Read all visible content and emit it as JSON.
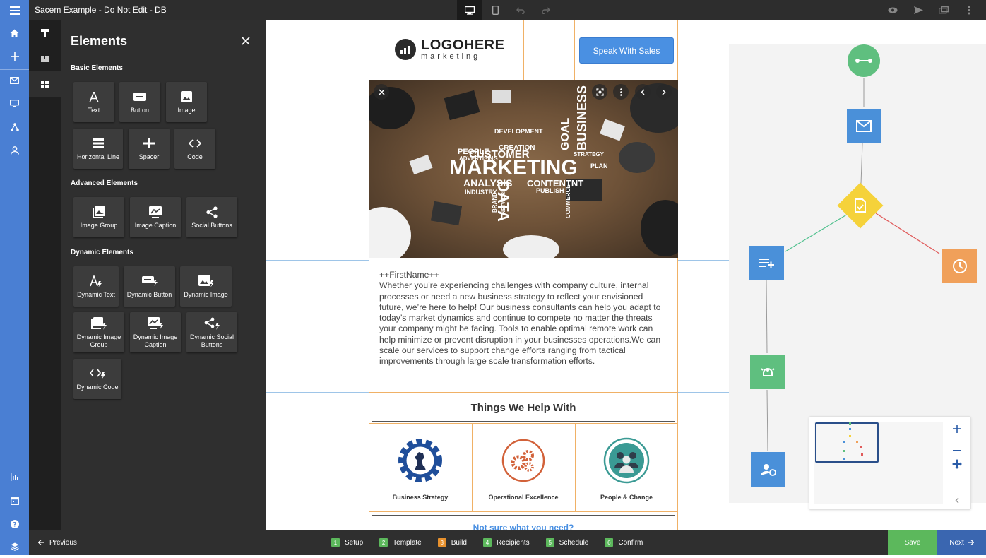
{
  "app": {
    "title": "Sacem Example - Do Not Edit - DB"
  },
  "panel": {
    "title": "Elements",
    "sections": {
      "basic": "Basic Elements",
      "advanced": "Advanced Elements",
      "dynamic": "Dynamic Elements"
    },
    "basic_items": [
      "Text",
      "Button",
      "Image",
      "Horizontal Line",
      "Spacer",
      "Code"
    ],
    "advanced_items": [
      "Image Group",
      "Image Caption",
      "Social Buttons"
    ],
    "dynamic_items": [
      "Dynamic Text",
      "Dynamic Button",
      "Dynamic Image",
      "Dynamic Image Group",
      "Dynamic Image Caption",
      "Dynamic Social Buttons",
      "Dynamic Code"
    ]
  },
  "email": {
    "logo_main": "LOGOHERE",
    "logo_sub": "marketing",
    "cta_button": "Speak With Sales",
    "greeting": "++FirstName++",
    "body": "Whether you’re experiencing challenges with company culture, internal processes or need a new business strategy to reflect your envisioned future, we’re here to help! Our business consultants can help you adapt to today’s market dynamics and continue to compete no matter the threats your company might be facing. Tools to enable optimal remote work can help minimize or prevent disruption in your businesses operations.We can scale our services to support change efforts ranging from tactical improvements through large scale transformation efforts.",
    "section_heading": "Things We Help With",
    "features": [
      "Business Strategy",
      "Operational Excellence",
      "People & Change"
    ],
    "footer_link": "Not sure what you need?",
    "hero_words": [
      "MARKETING",
      "DATA",
      "CUSTOMER",
      "BUSINESS",
      "GOAL",
      "ANALYSIS",
      "CONTENTNT",
      "CREATION",
      "DEVELOPMENT",
      "PEOPLE",
      "ADVERTISING",
      "INDUSTRY",
      "STRATEGY",
      "PLAN",
      "PUBLISH",
      "BRAND",
      "NETWORK",
      "COMMERCE"
    ]
  },
  "bottom": {
    "previous": "Previous",
    "steps": [
      {
        "num": "1",
        "label": "Setup",
        "color": "#5cb85c"
      },
      {
        "num": "2",
        "label": "Template",
        "color": "#5cb85c"
      },
      {
        "num": "3",
        "label": "Build",
        "color": "#e8912d"
      },
      {
        "num": "4",
        "label": "Recipients",
        "color": "#5cb85c"
      },
      {
        "num": "5",
        "label": "Schedule",
        "color": "#5cb85c"
      },
      {
        "num": "6",
        "label": "Confirm",
        "color": "#5cb85c"
      }
    ],
    "save": "Save",
    "next": "Next"
  },
  "colors": {
    "accent_blue": "#4a7fd3",
    "flow_green": "#5fbf7f",
    "flow_blue": "#4a90d9",
    "flow_yellow": "#f5d23a",
    "flow_orange": "#f0a05a"
  }
}
